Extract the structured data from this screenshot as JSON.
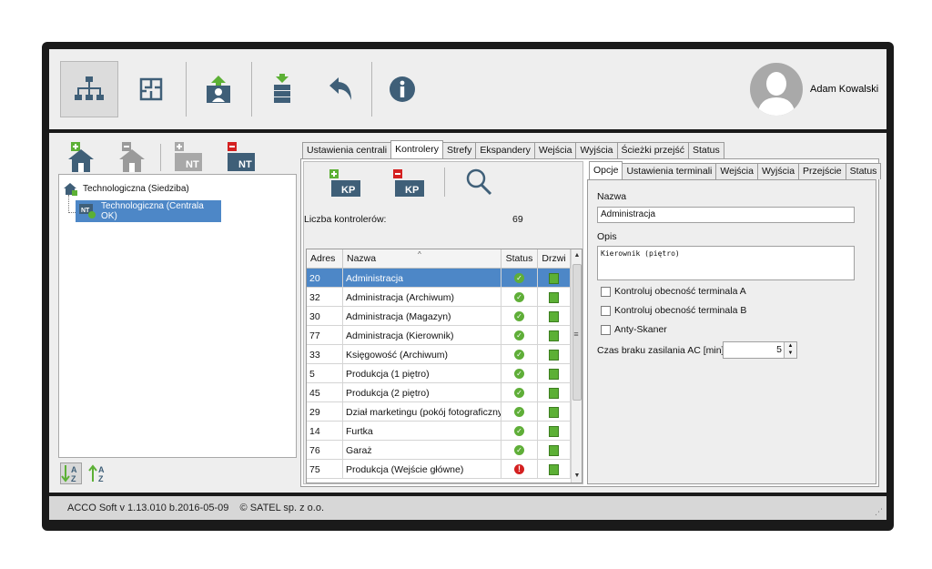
{
  "user": {
    "name": "Adam Kowalski"
  },
  "toolbar": {
    "icons": [
      "network-structure-icon",
      "floor-plan-icon",
      "upload-user-icon",
      "database-upload-icon",
      "undo-icon",
      "info-icon"
    ]
  },
  "tree": {
    "root_label": "Technologiczna (Siedziba)",
    "child_label": "Technologiczna (Centrala OK)",
    "node_badge": "NT"
  },
  "left_tools": {
    "badge_nt": "NT"
  },
  "main_tabs": [
    "Ustawienia centrali",
    "Kontrolery",
    "Strefy",
    "Ekspandery",
    "Wejścia",
    "Wyjścia",
    "Ścieżki przejść",
    "Status"
  ],
  "kp_tools": {
    "badge": "KP"
  },
  "controllers": {
    "count_label": "Liczba kontrolerów:",
    "count_value": "69",
    "columns": {
      "adres": "Adres",
      "nazwa": "Nazwa",
      "status": "Status",
      "drzwi": "Drzwi"
    },
    "rows": [
      {
        "adres": "20",
        "nazwa": "Administracja",
        "status": "ok"
      },
      {
        "adres": "32",
        "nazwa": "Administracja (Archiwum)",
        "status": "ok"
      },
      {
        "adres": "30",
        "nazwa": "Administracja (Magazyn)",
        "status": "ok"
      },
      {
        "adres": "77",
        "nazwa": "Administracja (Kierownik)",
        "status": "ok"
      },
      {
        "adres": "33",
        "nazwa": "Księgowość (Archiwum)",
        "status": "ok"
      },
      {
        "adres": "5",
        "nazwa": "Produkcja (1 piętro)",
        "status": "ok"
      },
      {
        "adres": "45",
        "nazwa": "Produkcja (2 piętro)",
        "status": "ok"
      },
      {
        "adres": "29",
        "nazwa": "Dział marketingu (pokój fotograficzny)",
        "status": "ok"
      },
      {
        "adres": "14",
        "nazwa": "Furtka",
        "status": "ok"
      },
      {
        "adres": "76",
        "nazwa": "Garaż",
        "status": "ok"
      },
      {
        "adres": "75",
        "nazwa": "Produkcja (Wejście główne)",
        "status": "error"
      }
    ]
  },
  "detail_tabs": [
    "Opcje",
    "Ustawienia terminali",
    "Wejścia",
    "Wyjścia",
    "Przejście",
    "Status"
  ],
  "detail": {
    "nazwa_label": "Nazwa",
    "nazwa_value": "Administracja",
    "opis_label": "Opis",
    "opis_value": "Kierownik (piętro)",
    "checkbox_a": "Kontroluj obecność terminala A",
    "checkbox_b": "Kontroluj obecność terminala B",
    "checkbox_anty": "Anty-Skaner",
    "ac_label": "Czas braku zasilania AC [min]",
    "ac_value": "5"
  },
  "statusbar": {
    "text": "ACCO Soft v 1.13.010 b.2016-05-09    © SATEL sp. z o.o."
  },
  "colors": {
    "accent": "#4d87c7",
    "icon_blue": "#3f5f78",
    "icon_green": "#5cb035",
    "icon_red": "#d42020"
  }
}
